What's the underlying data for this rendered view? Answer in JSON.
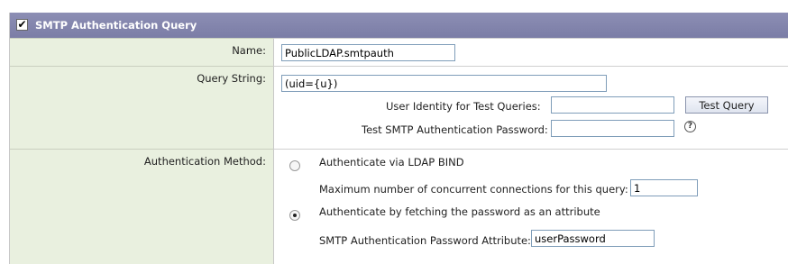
{
  "header": {
    "title": "SMTP Authentication Query",
    "checked": true,
    "check_glyph": "✔"
  },
  "rows": {
    "name": {
      "label": "Name:",
      "value": "PublicLDAP.smtpauth"
    },
    "query": {
      "label": "Query String:",
      "value": "(uid={u})",
      "test_identity_label": "User Identity for Test Queries:",
      "test_identity_value": "",
      "test_button": "Test Query",
      "test_password_label": "Test SMTP Authentication Password:",
      "test_password_value": "",
      "help_glyph": "?"
    },
    "auth": {
      "label": "Authentication Method:",
      "option_bind": "Authenticate via LDAP BIND",
      "option_bind_selected": false,
      "max_conn_label": "Maximum number of concurrent connections for this query:",
      "max_conn_value": "1",
      "option_fetch": "Authenticate by fetching the password as an attribute",
      "option_fetch_selected": true,
      "pwd_attr_label": "SMTP Authentication Password Attribute:",
      "pwd_attr_value": "userPassword"
    }
  },
  "colors": {
    "header_bg": "#7b7da6",
    "label_bg": "#e9f0df",
    "input_border": "#7f9db9"
  },
  "icons": {
    "header_checkbox": "checkbox-checked-icon",
    "help": "help-icon"
  }
}
